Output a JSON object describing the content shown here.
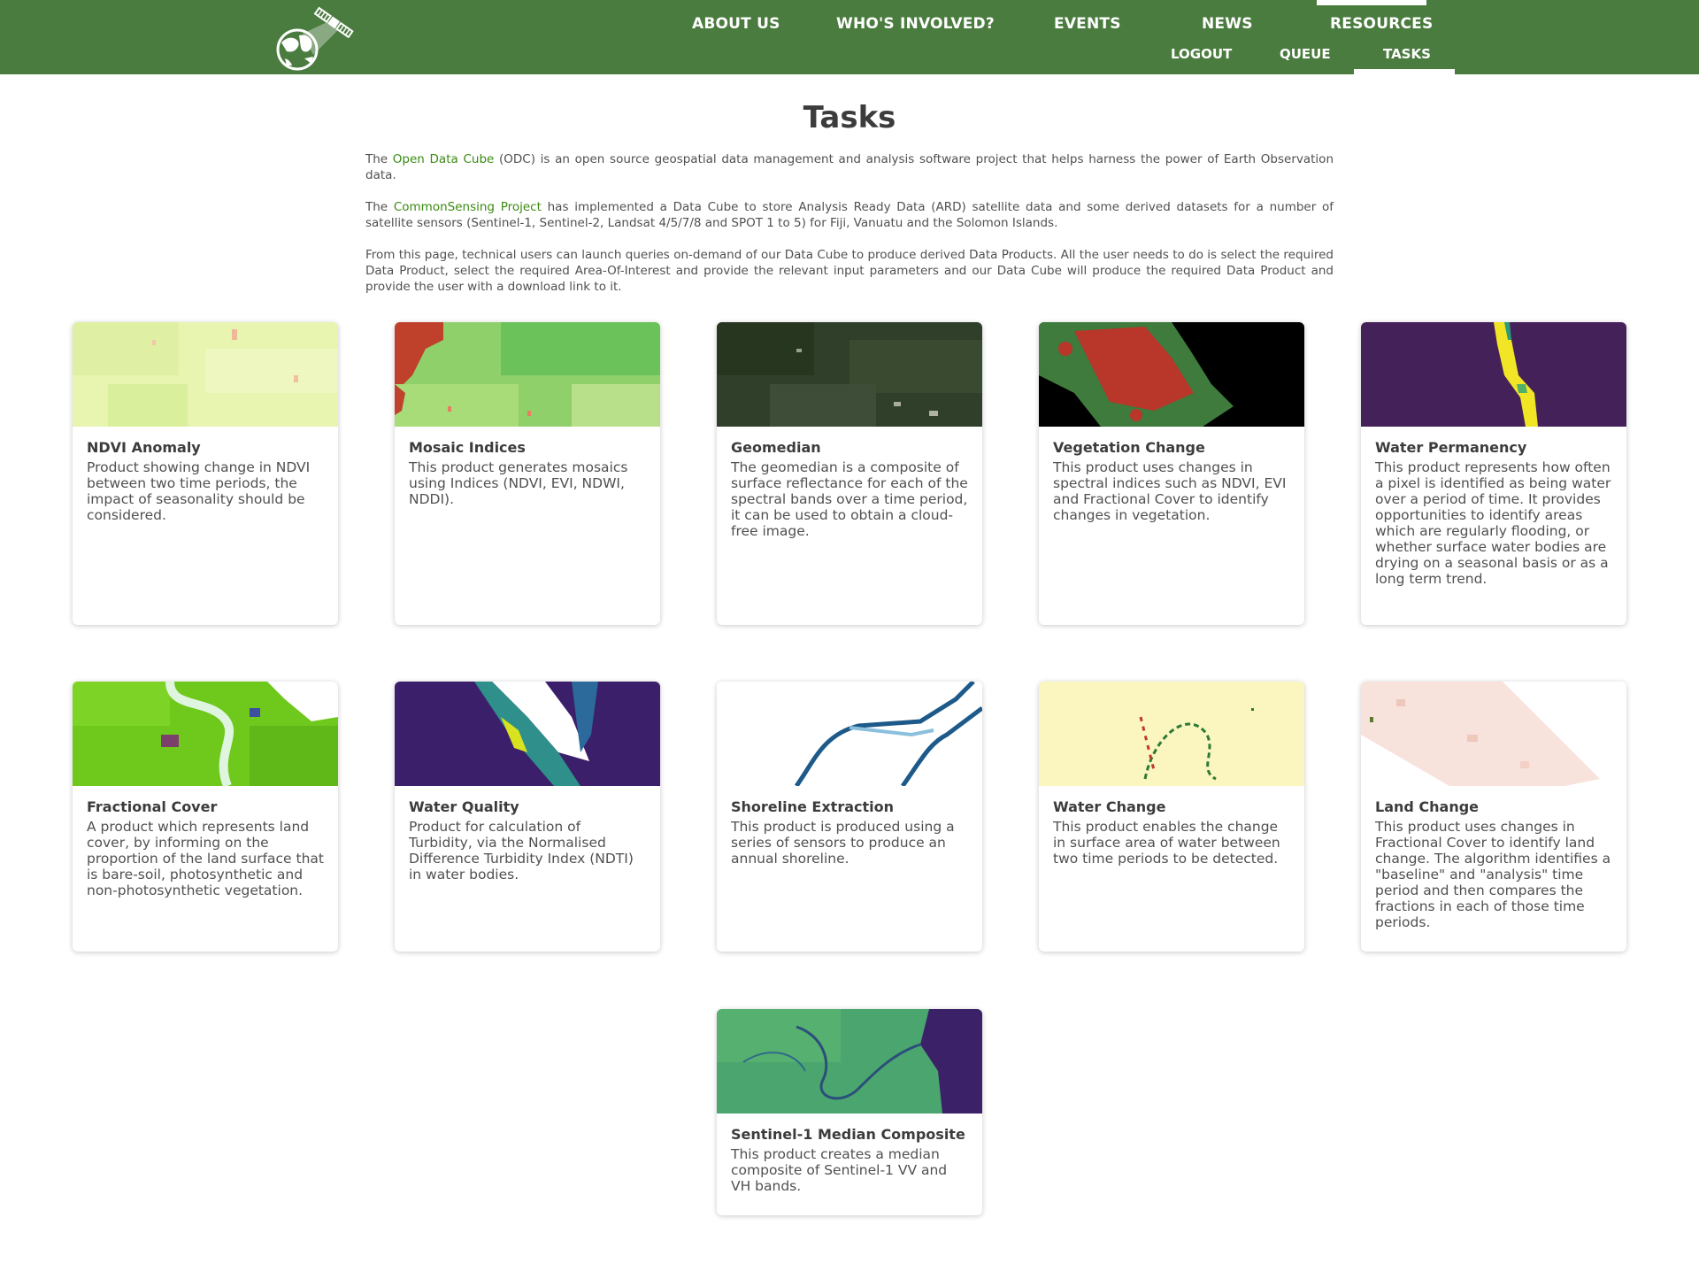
{
  "nav": {
    "main": [
      "ABOUT US",
      "WHO'S INVOLVED?",
      "EVENTS",
      "NEWS",
      "RESOURCES"
    ],
    "sub": [
      "LOGOUT",
      "QUEUE",
      "TASKS"
    ]
  },
  "page": {
    "title": "Tasks",
    "intro": {
      "p1_pre": "The ",
      "p1_link": "Open Data Cube",
      "p1_post": " (ODC) is an open source geospatial data management and analysis software project that helps harness the power of Earth Observation data.",
      "p2_pre": "The ",
      "p2_link": "CommonSensing Project",
      "p2_post": " has implemented a Data Cube to store Analysis Ready Data (ARD) satellite data and some derived datasets for a number of satellite sensors (Sentinel-1, Sentinel-2, Landsat 4/5/7/8 and SPOT 1 to 5) for Fiji, Vanuatu and the Solomon Islands.",
      "p3": "From this page, technical users can launch queries on-demand of our Data Cube to produce derived Data Products. All the user needs to do is select the required Data Product, select the required Area-Of-Interest and provide the relevant input parameters and our Data Cube will produce the required Data Product and provide the user with a download link to it."
    }
  },
  "cards": [
    {
      "title": "NDVI Anomaly",
      "desc": "Product showing change in NDVI between two time periods, the impact of seasonality should be considered."
    },
    {
      "title": "Mosaic Indices",
      "desc": "This product generates mosaics using Indices (NDVI, EVI, NDWI, NDDI)."
    },
    {
      "title": "Geomedian",
      "desc": "The geomedian is a composite of surface reflectance for each of the spectral bands over a time period, it can be used to obtain a cloud-free image."
    },
    {
      "title": "Vegetation Change",
      "desc": "This product uses changes in spectral indices such as NDVI, EVI and Fractional Cover to identify changes in vegetation."
    },
    {
      "title": "Water Permanency",
      "desc": "This product represents how often a pixel is identified as being water over a period of time. It provides opportunities to identify areas which are regularly flooding, or whether surface water bodies are drying on a seasonal basis or as a long term trend."
    },
    {
      "title": "Fractional Cover",
      "desc": "A product which represents land cover, by informing on the proportion of the land surface that is bare-soil, photosynthetic and non-photosynthetic vegetation."
    },
    {
      "title": "Water Quality",
      "desc": "Product for calculation of Turbidity, via the Normalised Difference Turbidity Index (NDTI) in water bodies."
    },
    {
      "title": "Shoreline Extraction",
      "desc": "This product is produced using a series of sensors to produce an annual shoreline."
    },
    {
      "title": "Water Change",
      "desc": "This product enables the change in surface area of water between two time periods to be detected."
    },
    {
      "title": "Land Change",
      "desc": "This product uses changes in Fractional Cover to identify land change. The algorithm identifies a \"baseline\" and \"analysis\" time period and then compares the fractions in each of those time periods."
    },
    {
      "title": "Sentinel-1 Median Composite",
      "desc": "This product creates a median composite of Sentinel-1 VV and VH bands."
    }
  ]
}
